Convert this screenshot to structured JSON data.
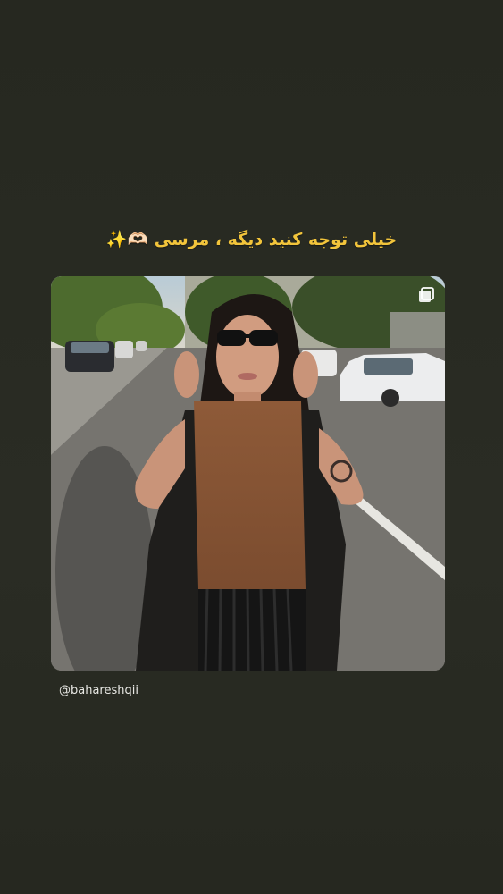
{
  "story": {
    "caption": "خیلی توجه کنید دیگه ، مرسی 🫶🏻✨",
    "handle": "@bahareshqii",
    "caption_color": "#f2c43b",
    "background_color": "#272921"
  },
  "post": {
    "image_alt": "woman in sunglasses standing on a sunny street",
    "icon": "multiple-posts-icon"
  }
}
